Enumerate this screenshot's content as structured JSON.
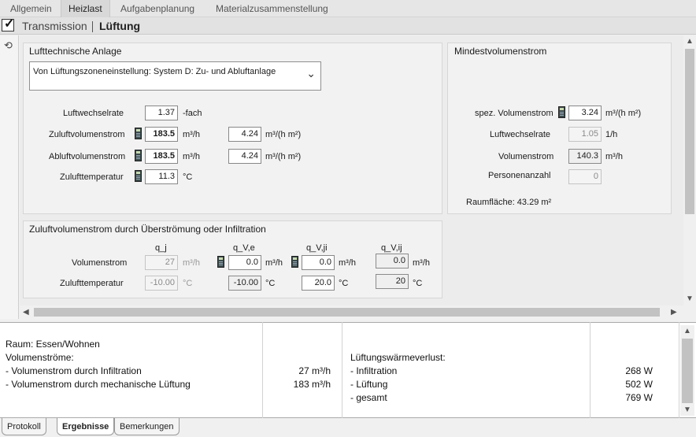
{
  "tabs": [
    "Allgemein",
    "Heizlast",
    "Aufgabenplanung",
    "Materialzusammenstellung"
  ],
  "active_tab": "Heizlast",
  "subtabs": [
    "Transmission",
    "Lüftung"
  ],
  "lta": {
    "title": "Lufttechnische Anlage",
    "dropdown_value": "Von Lüftungszoneneinstellung: System D: Zu- und Abluftanlage",
    "luftwechselrate": {
      "label": "Luftwechselrate",
      "value": "1.37",
      "unit": "-fach"
    },
    "zuluft": {
      "label": "Zuluftvolumenstrom",
      "value": "183.5",
      "unit": "m³/h",
      "value2": "4.24",
      "unit2": "m³/(h m²)"
    },
    "abluft": {
      "label": "Abluftvolumenstrom",
      "value": "183.5",
      "unit": "m³/h",
      "value2": "4.24",
      "unit2": "m³/(h m²)"
    },
    "temp": {
      "label": "Zulufttemperatur",
      "value": "11.3",
      "unit": "°C"
    }
  },
  "mind": {
    "title": "Mindestvolumenstrom",
    "spez": {
      "label": "spez. Volumenstrom",
      "value": "3.24",
      "unit": "m³/(h m²)"
    },
    "lwr": {
      "label": "Luftwechselrate",
      "value": "1.05",
      "unit": "1/h"
    },
    "vol": {
      "label": "Volumenstrom",
      "value": "140.3",
      "unit": "m³/h"
    },
    "pers": {
      "label": "Personenanzahl",
      "value": "0"
    },
    "raumflaeche": "Raumfläche: 43.29 m²"
  },
  "zuv": {
    "title": "Zuluftvolumenstrom durch Überströmung oder Infiltration",
    "headers": [
      "q_j",
      "q_V,e",
      "q_V,ji",
      "q_V,ij"
    ],
    "row1": {
      "label": "Volumenstrom",
      "values": [
        "27",
        "0.0",
        "0.0",
        "0.0"
      ],
      "unit": "m³/h"
    },
    "row2": {
      "label": "Zulufttemperatur",
      "values": [
        "-10.00",
        "-10.00",
        "20.0",
        "20"
      ],
      "unit": "°C"
    }
  },
  "results": {
    "raum": "Raum: Essen/Wohnen",
    "vol_title": "Volumenströme:",
    "vol_inf": "- Volumenstrom durch Infiltration",
    "vol_inf_val": "27 m³/h",
    "vol_mech": "- Volumenstrom durch mechanische Lüftung",
    "vol_mech_val": "183 m³/h",
    "lwv_title": "Lüftungswärmeverlust:",
    "lwv_inf": "- Infiltration",
    "lwv_inf_val": "268 W",
    "lwv_lue": "- Lüftung",
    "lwv_lue_val": "502 W",
    "lwv_ges": "- gesamt",
    "lwv_ges_val": "769 W"
  },
  "bottom_tabs": [
    "Protokoll",
    "Ergebnisse",
    "Bemerkungen"
  ],
  "active_bottom_tab": "Ergebnisse"
}
